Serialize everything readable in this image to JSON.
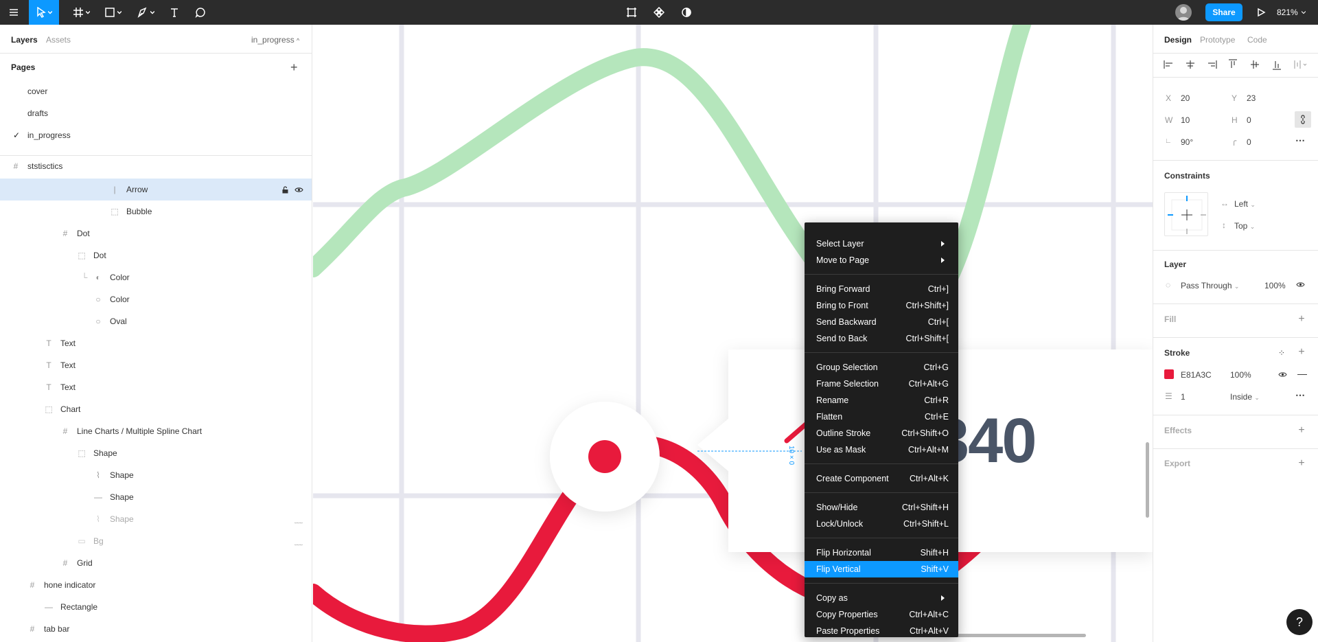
{
  "toolbar": {
    "share_label": "Share",
    "zoom": "821%"
  },
  "left_panel": {
    "tabs": {
      "layers": "Layers",
      "assets": "Assets"
    },
    "current_page": "in_progress",
    "pages_header": "Pages",
    "pages": [
      "cover",
      "drafts",
      "in_progress"
    ],
    "layers": [
      {
        "label": "ststisctics",
        "icon": "frame-icon"
      },
      {
        "label": "Arrow",
        "icon": "line-icon",
        "selected": true
      },
      {
        "label": "Bubble",
        "icon": "group-icon"
      },
      {
        "label": "Dot",
        "icon": "frame-icon"
      },
      {
        "label": "Dot",
        "icon": "group-icon"
      },
      {
        "label": "Color",
        "icon": "half-circle-icon"
      },
      {
        "label": "Color",
        "icon": "ellipse-icon"
      },
      {
        "label": "Oval",
        "icon": "ellipse-icon"
      },
      {
        "label": "Text",
        "icon": "text-icon"
      },
      {
        "label": "Text",
        "icon": "text-icon"
      },
      {
        "label": "Text",
        "icon": "text-icon"
      },
      {
        "label": "Chart",
        "icon": "group-icon"
      },
      {
        "label": "Line Charts / Multiple Spline Chart",
        "icon": "frame-icon"
      },
      {
        "label": "Shape",
        "icon": "group-icon"
      },
      {
        "label": "Shape",
        "icon": "vector-icon"
      },
      {
        "label": "Shape",
        "icon": "line-icon"
      },
      {
        "label": "Shape",
        "icon": "vector-icon",
        "hidden": true
      },
      {
        "label": "Bg",
        "icon": "rectangle-icon",
        "hidden": true
      },
      {
        "label": "Grid",
        "icon": "frame-icon"
      },
      {
        "label": "hone indicator",
        "icon": "frame-icon"
      },
      {
        "label": "Rectangle",
        "icon": "line-icon"
      },
      {
        "label": "tab bar",
        "icon": "frame-icon"
      }
    ]
  },
  "canvas": {
    "big_number": "340",
    "measure_label": "10 × 0",
    "colors": {
      "green": "#b5e6bc",
      "red": "#e81a3c",
      "grid": "#e6e6ee"
    }
  },
  "right_panel": {
    "tabs": {
      "design": "Design",
      "prototype": "Prototype",
      "code": "Code"
    },
    "x_label": "X",
    "x": "20",
    "y_label": "Y",
    "y": "23",
    "w_label": "W",
    "w": "10",
    "h_label": "H",
    "h": "0",
    "rotation": "90°",
    "radius": "0",
    "constraints_title": "Constraints",
    "constraint_h": "Left",
    "constraint_v": "Top",
    "layer_title": "Layer",
    "blend": "Pass Through",
    "layer_opacity": "100%",
    "fill_title": "Fill",
    "stroke_title": "Stroke",
    "stroke_color": "E81A3C",
    "stroke_color_hex": "#e81a3c",
    "stroke_opacity": "100%",
    "stroke_weight": "1",
    "stroke_align": "Inside",
    "effects_title": "Effects",
    "export_title": "Export"
  },
  "context_menu": {
    "items": [
      {
        "label": "Select Layer",
        "shortcut": "",
        "submenu": true
      },
      {
        "label": "Move to Page",
        "shortcut": "",
        "submenu": true
      },
      {
        "label": "Bring Forward",
        "shortcut": "Ctrl+]"
      },
      {
        "label": "Bring to Front",
        "shortcut": "Ctrl+Shift+]"
      },
      {
        "label": "Send Backward",
        "shortcut": "Ctrl+["
      },
      {
        "label": "Send to Back",
        "shortcut": "Ctrl+Shift+["
      },
      {
        "label": "Group Selection",
        "shortcut": "Ctrl+G"
      },
      {
        "label": "Frame Selection",
        "shortcut": "Ctrl+Alt+G"
      },
      {
        "label": "Rename",
        "shortcut": "Ctrl+R"
      },
      {
        "label": "Flatten",
        "shortcut": "Ctrl+E"
      },
      {
        "label": "Outline Stroke",
        "shortcut": "Ctrl+Shift+O"
      },
      {
        "label": "Use as Mask",
        "shortcut": "Ctrl+Alt+M"
      },
      {
        "label": "Create Component",
        "shortcut": "Ctrl+Alt+K"
      },
      {
        "label": "Show/Hide",
        "shortcut": "Ctrl+Shift+H"
      },
      {
        "label": "Lock/Unlock",
        "shortcut": "Ctrl+Shift+L"
      },
      {
        "label": "Flip Horizontal",
        "shortcut": "Shift+H"
      },
      {
        "label": "Flip Vertical",
        "shortcut": "Shift+V",
        "highlighted": true
      },
      {
        "label": "Copy as",
        "shortcut": "",
        "submenu": true
      },
      {
        "label": "Copy Properties",
        "shortcut": "Ctrl+Alt+C"
      },
      {
        "label": "Paste Properties",
        "shortcut": "Ctrl+Alt+V"
      }
    ]
  },
  "help": "?"
}
